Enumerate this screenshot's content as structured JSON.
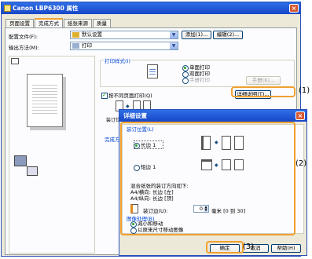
{
  "window": {
    "title": "Canon LBP6300 属性"
  },
  "tabs": [
    "页面设置",
    "完成方式",
    "纸张来源",
    "质量"
  ],
  "profile": {
    "label": "配置文件(F):",
    "value": "默认设置",
    "add": "添加(1)...",
    "edit": "编辑(2)..."
  },
  "output": {
    "label": "输出方法(M):",
    "value": "打印"
  },
  "print_style": {
    "label": "打印样式(I)",
    "options": [
      "单面打印",
      "双面打印",
      "手册打印"
    ],
    "booklet_btn": "手册(K)..."
  },
  "collate_chk": "按不同页面打印(Q)",
  "detail_btn": "详细说明(T)...",
  "binding_label": "装订位置(G)",
  "finishing_label": "完成方式(H)",
  "callouts": {
    "c1": "(1)",
    "c2": "(2)",
    "c3": "(3)"
  },
  "dialog": {
    "title": "详细设置",
    "binding_group": "装订位置(L)",
    "long_edge": "长边 1",
    "short_edge": "短边 1",
    "note_title": "混合纸张的装订方向如下:",
    "note_line1": "A4/横向: 长边 [左]",
    "note_line2": "A4/纵向: 长边 [顶]",
    "gutter_label": "装订边(U):",
    "gutter_value": "0",
    "gutter_range": "毫米 [0 到 30]",
    "reduce_group": "图像处理(B)",
    "reduce_opt1": "减小和移动",
    "reduce_opt2": "以原来尺寸移动图像",
    "ok": "确定",
    "cancel": "取消",
    "help": "帮助(H)"
  },
  "colors": {
    "titlebar": "#1f56d6",
    "highlight": "#f0a030",
    "accent_text": "#0046d5"
  }
}
